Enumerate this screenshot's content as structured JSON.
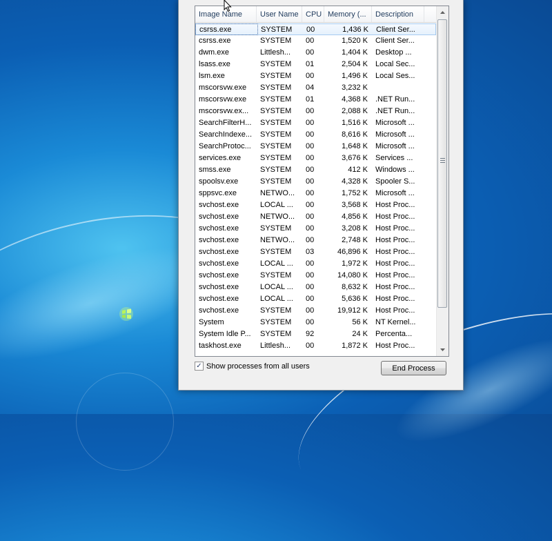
{
  "columns": [
    "Image Name",
    "User Name",
    "CPU",
    "Memory (...",
    "Description"
  ],
  "processes": [
    {
      "image": "csrss.exe",
      "user": "SYSTEM",
      "cpu": "00",
      "memory": "1,436 K",
      "desc": "Client Ser..."
    },
    {
      "image": "csrss.exe",
      "user": "SYSTEM",
      "cpu": "00",
      "memory": "1,520 K",
      "desc": "Client Ser..."
    },
    {
      "image": "dwm.exe",
      "user": "Littlesh...",
      "cpu": "00",
      "memory": "1,404 K",
      "desc": "Desktop ..."
    },
    {
      "image": "lsass.exe",
      "user": "SYSTEM",
      "cpu": "01",
      "memory": "2,504 K",
      "desc": "Local Sec..."
    },
    {
      "image": "lsm.exe",
      "user": "SYSTEM",
      "cpu": "00",
      "memory": "1,496 K",
      "desc": "Local Ses..."
    },
    {
      "image": "mscorsvw.exe",
      "user": "SYSTEM",
      "cpu": "04",
      "memory": "3,232 K",
      "desc": ""
    },
    {
      "image": "mscorsvw.exe",
      "user": "SYSTEM",
      "cpu": "01",
      "memory": "4,368 K",
      "desc": ".NET Run..."
    },
    {
      "image": "mscorsvw.ex...",
      "user": "SYSTEM",
      "cpu": "00",
      "memory": "2,088 K",
      "desc": ".NET Run..."
    },
    {
      "image": "SearchFilterH...",
      "user": "SYSTEM",
      "cpu": "00",
      "memory": "1,516 K",
      "desc": "Microsoft ..."
    },
    {
      "image": "SearchIndexe...",
      "user": "SYSTEM",
      "cpu": "00",
      "memory": "8,616 K",
      "desc": "Microsoft ..."
    },
    {
      "image": "SearchProtoc...",
      "user": "SYSTEM",
      "cpu": "00",
      "memory": "1,648 K",
      "desc": "Microsoft ..."
    },
    {
      "image": "services.exe",
      "user": "SYSTEM",
      "cpu": "00",
      "memory": "3,676 K",
      "desc": "Services ..."
    },
    {
      "image": "smss.exe",
      "user": "SYSTEM",
      "cpu": "00",
      "memory": "412 K",
      "desc": "Windows ..."
    },
    {
      "image": "spoolsv.exe",
      "user": "SYSTEM",
      "cpu": "00",
      "memory": "4,328 K",
      "desc": "Spooler S..."
    },
    {
      "image": "sppsvc.exe",
      "user": "NETWO...",
      "cpu": "00",
      "memory": "1,752 K",
      "desc": "Microsoft ..."
    },
    {
      "image": "svchost.exe",
      "user": "LOCAL ...",
      "cpu": "00",
      "memory": "3,568 K",
      "desc": "Host Proc..."
    },
    {
      "image": "svchost.exe",
      "user": "NETWO...",
      "cpu": "00",
      "memory": "4,856 K",
      "desc": "Host Proc..."
    },
    {
      "image": "svchost.exe",
      "user": "SYSTEM",
      "cpu": "00",
      "memory": "3,208 K",
      "desc": "Host Proc..."
    },
    {
      "image": "svchost.exe",
      "user": "NETWO...",
      "cpu": "00",
      "memory": "2,748 K",
      "desc": "Host Proc..."
    },
    {
      "image": "svchost.exe",
      "user": "SYSTEM",
      "cpu": "03",
      "memory": "46,896 K",
      "desc": "Host Proc..."
    },
    {
      "image": "svchost.exe",
      "user": "LOCAL ...",
      "cpu": "00",
      "memory": "1,972 K",
      "desc": "Host Proc..."
    },
    {
      "image": "svchost.exe",
      "user": "SYSTEM",
      "cpu": "00",
      "memory": "14,080 K",
      "desc": "Host Proc..."
    },
    {
      "image": "svchost.exe",
      "user": "LOCAL ...",
      "cpu": "00",
      "memory": "8,632 K",
      "desc": "Host Proc..."
    },
    {
      "image": "svchost.exe",
      "user": "LOCAL ...",
      "cpu": "00",
      "memory": "5,636 K",
      "desc": "Host Proc..."
    },
    {
      "image": "svchost.exe",
      "user": "SYSTEM",
      "cpu": "00",
      "memory": "19,912 K",
      "desc": "Host Proc..."
    },
    {
      "image": "System",
      "user": "SYSTEM",
      "cpu": "00",
      "memory": "56 K",
      "desc": "NT Kernel..."
    },
    {
      "image": "System Idle P...",
      "user": "SYSTEM",
      "cpu": "92",
      "memory": "24 K",
      "desc": "Percenta..."
    },
    {
      "image": "taskhost.exe",
      "user": "Littlesh...",
      "cpu": "00",
      "memory": "1,872 K",
      "desc": "Host Proc..."
    }
  ],
  "show_all_label": "Show processes from all users",
  "show_all_checked": "✓",
  "end_process_label": "End Process",
  "icons": [
    "scroll-up-icon",
    "scroll-down-icon",
    "scroll-grip-icon",
    "mouse-cursor-icon",
    "checkmark-icon"
  ]
}
